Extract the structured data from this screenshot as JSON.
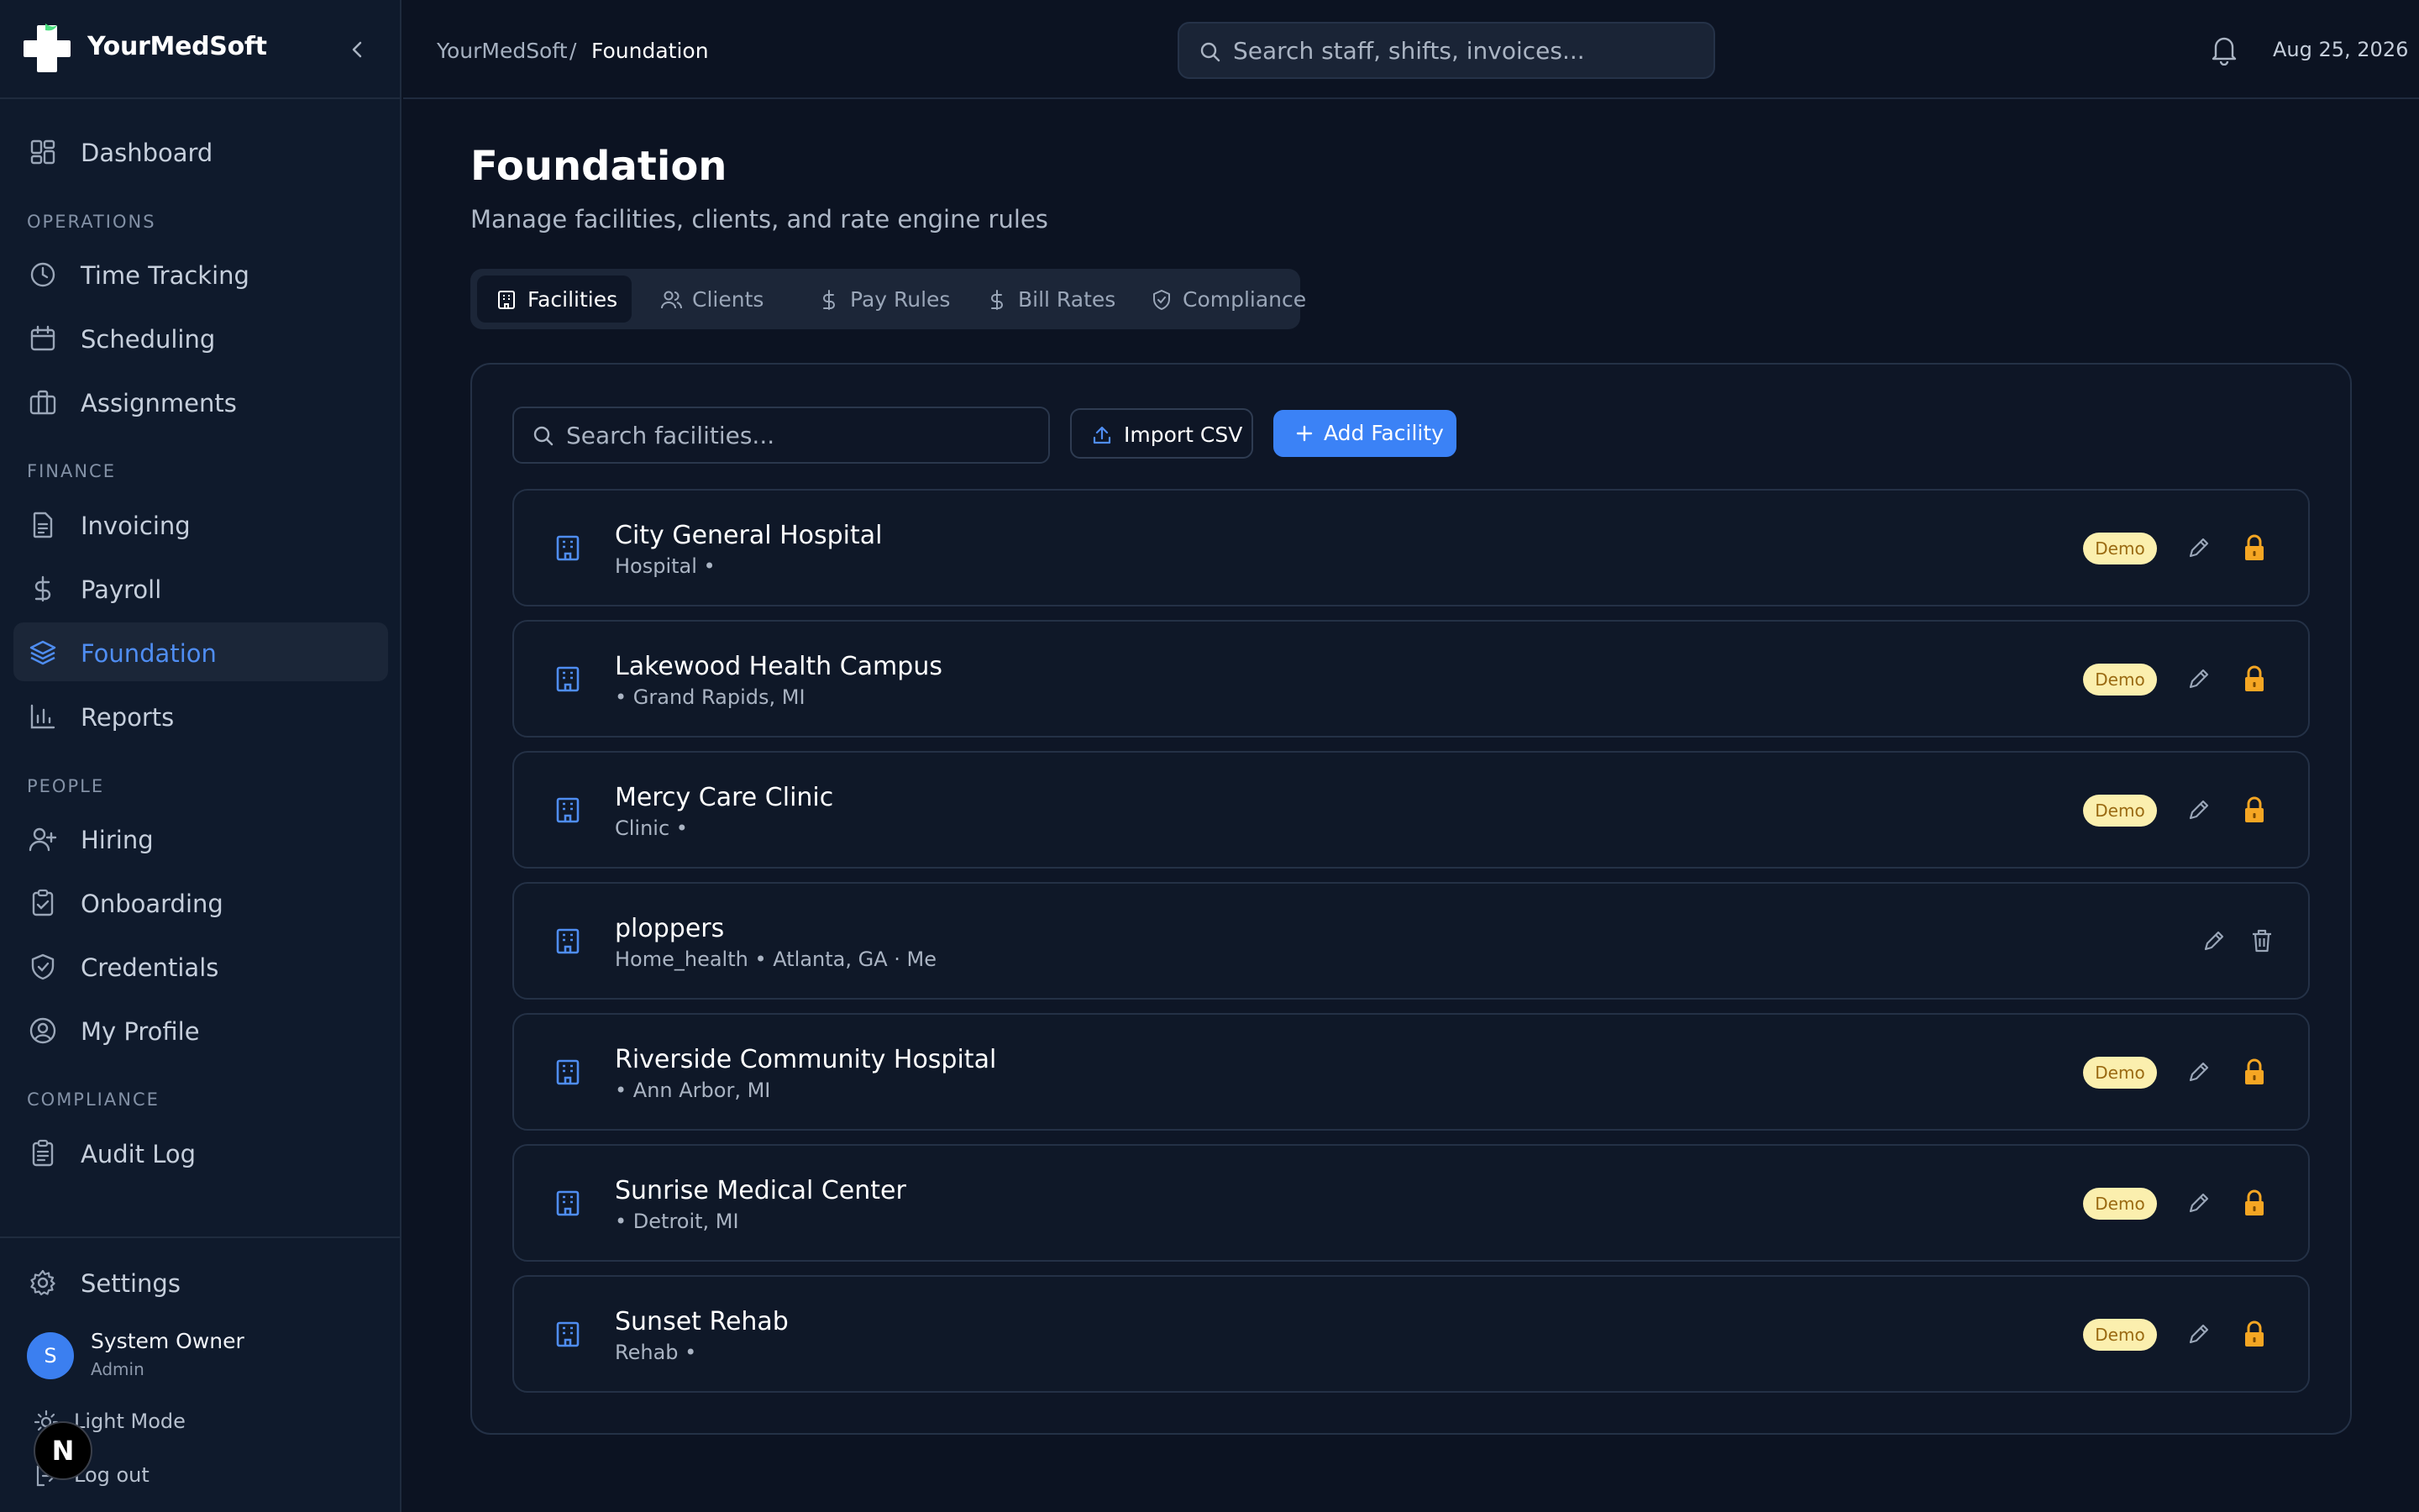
{
  "app": {
    "name": "YourMedSoft"
  },
  "sidebar": {
    "dashboard": "Dashboard",
    "sections": {
      "operations": "OPERATIONS",
      "finance": "FINANCE",
      "people": "PEOPLE",
      "compliance": "COMPLIANCE"
    },
    "items": {
      "time_tracking": "Time Tracking",
      "scheduling": "Scheduling",
      "assignments": "Assignments",
      "invoicing": "Invoicing",
      "payroll": "Payroll",
      "foundation": "Foundation",
      "reports": "Reports",
      "hiring": "Hiring",
      "onboarding": "Onboarding",
      "credentials": "Credentials",
      "my_profile": "My Profile",
      "audit_log": "Audit Log"
    },
    "active": "Foundation",
    "settings": "Settings",
    "user": {
      "initial": "S",
      "name": "System Owner",
      "role": "Admin"
    },
    "light_mode": "Light Mode",
    "logout": "Log out",
    "dev_badge": "N"
  },
  "topbar": {
    "breadcrumb": [
      "YourMedSoft",
      "/",
      "Foundation"
    ],
    "search_placeholder": "Search staff, shifts, invoices...",
    "date": "Aug 25, 2026"
  },
  "page": {
    "title": "Foundation",
    "subtitle": "Manage facilities, clients, and rate engine rules"
  },
  "tabs": [
    "Facilities",
    "Clients",
    "Pay Rules",
    "Bill Rates",
    "Compliance"
  ],
  "active_tab": "Facilities",
  "toolbar": {
    "search_placeholder": "Search facilities...",
    "import_label": "Import CSV",
    "add_label": "Add Facility"
  },
  "facilities": [
    {
      "name": "City General Hospital",
      "meta": "Hospital •",
      "badge": "Demo"
    },
    {
      "name": "Lakewood Health Campus",
      "meta": "• Grand Rapids, MI",
      "badge": "Demo"
    },
    {
      "name": "Mercy Care Clinic",
      "meta": "Clinic •",
      "badge": "Demo"
    },
    {
      "name": "ploppers",
      "meta": "Home_health • Atlanta, GA · Me",
      "badge": ""
    },
    {
      "name": "Riverside Community Hospital",
      "meta": "• Ann Arbor, MI",
      "badge": "Demo"
    },
    {
      "name": "Sunrise Medical Center",
      "meta": "• Detroit, MI",
      "badge": "Demo"
    },
    {
      "name": "Sunset Rehab",
      "meta": "Rehab •",
      "badge": "Demo"
    }
  ],
  "icons": {
    "logo": "medical-cross-icon",
    "row": "building-icon",
    "edit": "pencil-icon",
    "locked": "lock-icon",
    "delete": "trash-icon"
  },
  "colors": {
    "accent": "#3b82f6",
    "active_nav_text": "#4f8df2",
    "badge_bg": "#fbefae",
    "badge_text": "#9a6a12",
    "lock": "#f5a623",
    "background": "#0c1322"
  }
}
